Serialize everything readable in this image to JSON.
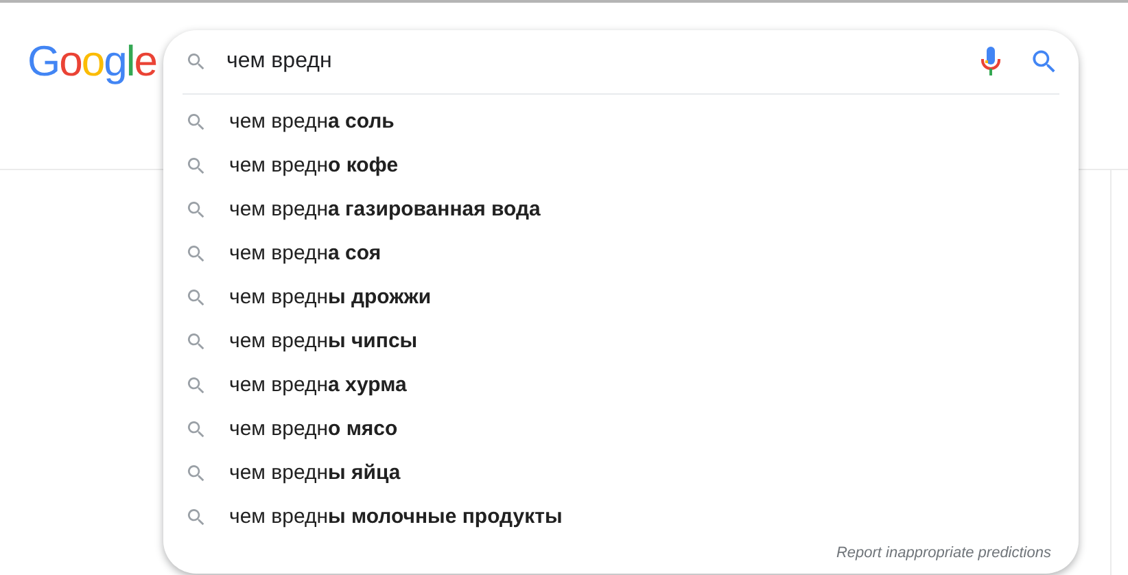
{
  "logo": "Google",
  "search": {
    "value": "чем вредн"
  },
  "suggestions": [
    "чем вредн**а соль**",
    "чем вредн**о кофе**",
    "чем вредн**а газированная вода**",
    "чем вредн**а соя**",
    "чем вредн**ы дрожжи**",
    "чем вредн**ы чипсы**",
    "чем вредн**а хурма**",
    "чем вредн**о мясо**",
    "чем вредн**ы яйца**",
    "чем вредн**ы молочные продукты**"
  ],
  "report_link": "Report inappropriate predictions"
}
